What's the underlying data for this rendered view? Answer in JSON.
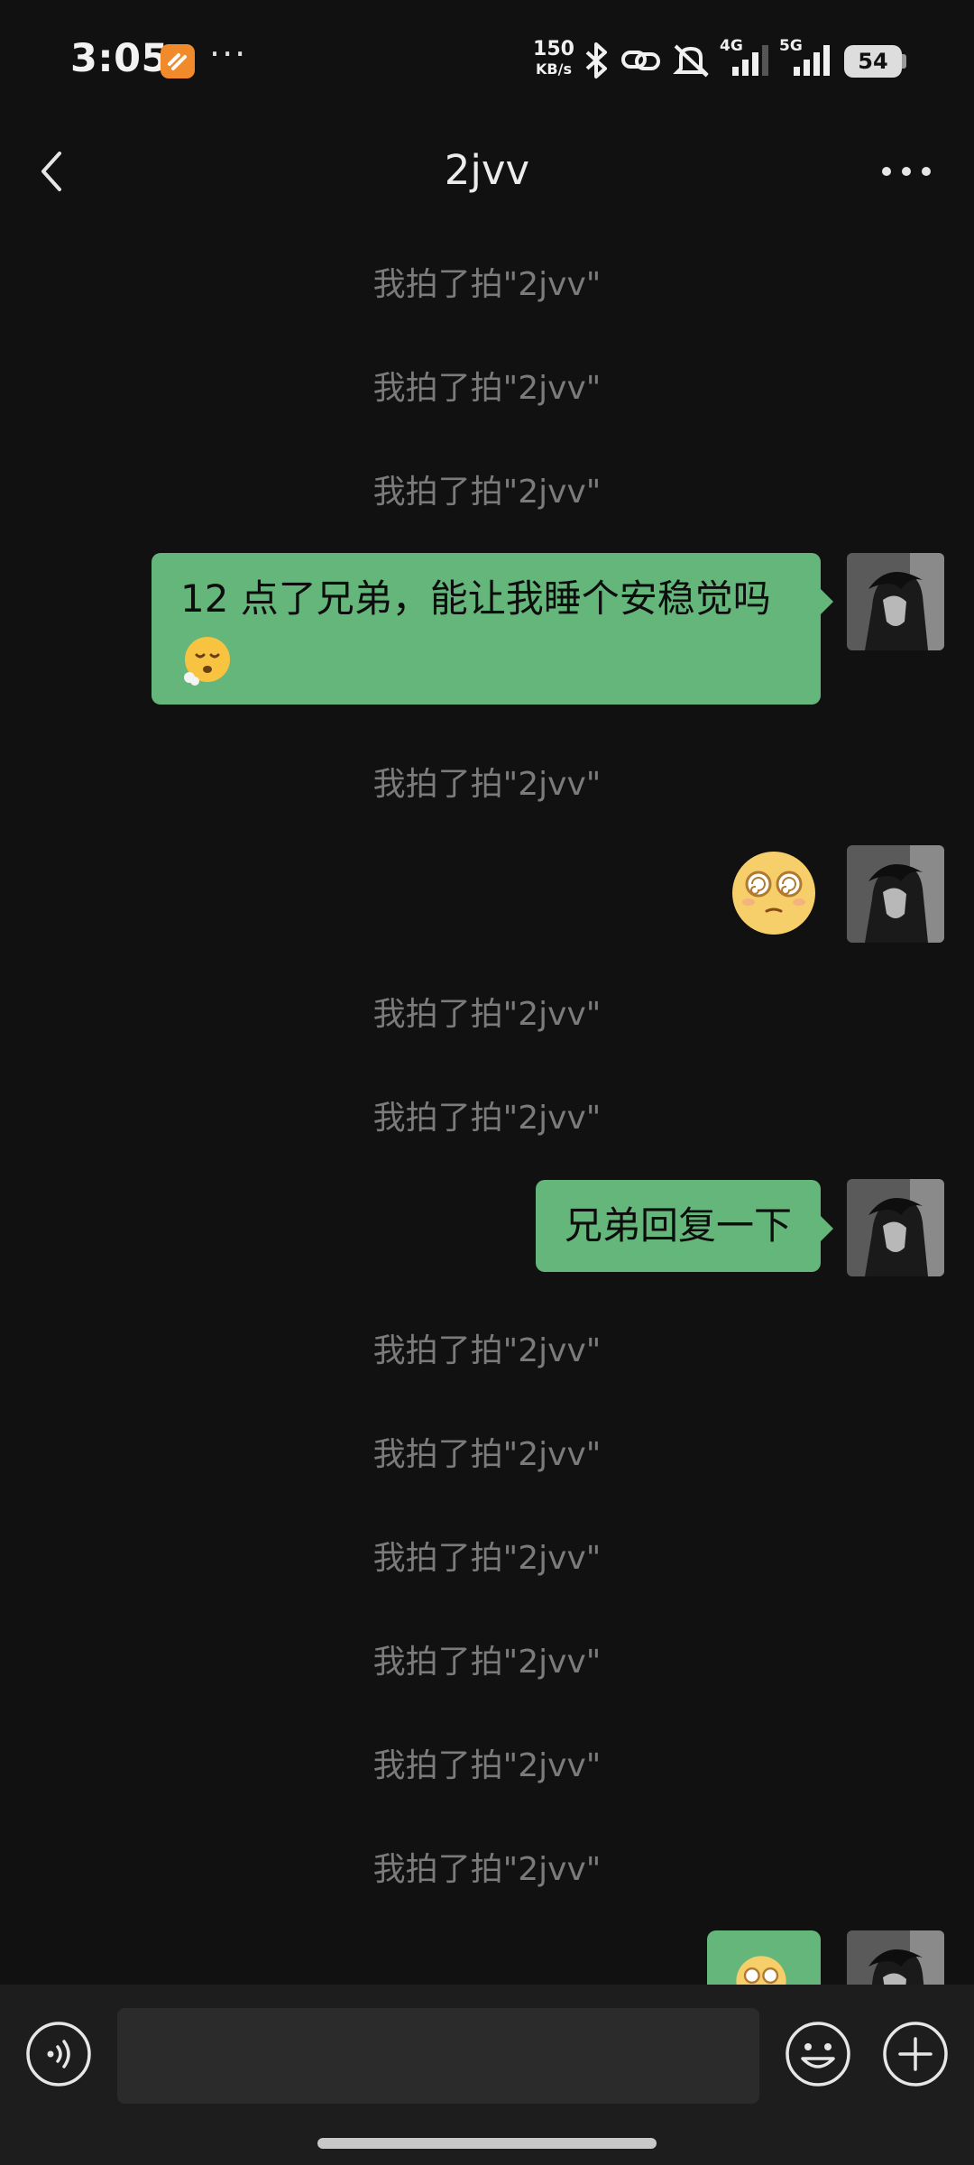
{
  "status_bar": {
    "time": "3:05",
    "overflow": "···",
    "net_speed_value": "150",
    "net_speed_unit": "KB/s",
    "icons": [
      "app-notification-icon",
      "bluetooth-icon",
      "hotspot-icon",
      "mute-icon",
      "signal-4g-icon",
      "signal-5g-icon"
    ],
    "battery": "54"
  },
  "header": {
    "title": "2jvv",
    "back_icon": "chevron-left-icon",
    "more_icon": "more-horizontal-icon"
  },
  "messages": [
    {
      "type": "system",
      "text": "我拍了拍\"2jvv\""
    },
    {
      "type": "system",
      "text": "我拍了拍\"2jvv\""
    },
    {
      "type": "system",
      "text": "我拍了拍\"2jvv\""
    },
    {
      "type": "outgoing-text",
      "line1": "12 点了兄弟，能让我睡个安稳觉吗",
      "emoji": "sigh-face-emoji"
    },
    {
      "type": "system",
      "text": "我拍了拍\"2jvv\""
    },
    {
      "type": "outgoing-sticker",
      "sticker": "dizzy-face-emoji"
    },
    {
      "type": "system",
      "text": "我拍了拍\"2jvv\""
    },
    {
      "type": "system",
      "text": "我拍了拍\"2jvv\""
    },
    {
      "type": "outgoing-text",
      "text": "兄弟回复一下"
    },
    {
      "type": "system",
      "text": "我拍了拍\"2jvv\""
    },
    {
      "type": "system",
      "text": "我拍了拍\"2jvv\""
    },
    {
      "type": "system",
      "text": "我拍了拍\"2jvv\""
    },
    {
      "type": "system",
      "text": "我拍了拍\"2jvv\""
    },
    {
      "type": "system",
      "text": "我拍了拍\"2jvv\""
    },
    {
      "type": "system",
      "text": "我拍了拍\"2jvv\""
    },
    {
      "type": "outgoing-sticker",
      "sticker": "dizzy-face-emoji"
    }
  ],
  "input_bar": {
    "voice_icon": "voice-icon",
    "message_value": "",
    "emoji_icon": "smiley-icon",
    "plus_icon": "plus-circle-icon"
  },
  "colors": {
    "background": "#111111",
    "bubble_outgoing": "#65b67b",
    "system_text": "#7b7b7b",
    "input_bar": "#1d1d1d"
  }
}
